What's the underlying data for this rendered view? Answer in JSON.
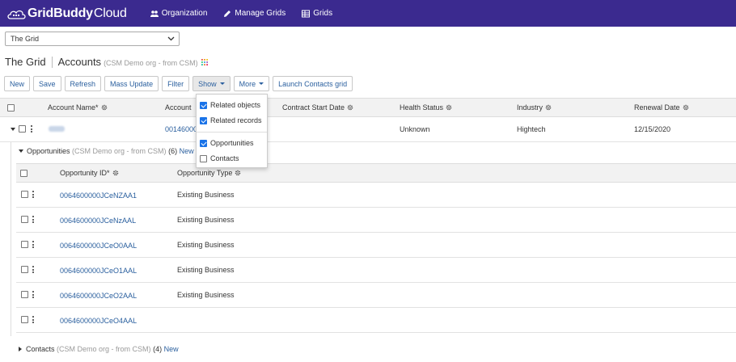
{
  "brand": {
    "name_bold": "GridBuddy",
    "name_light": "Cloud"
  },
  "nav": [
    {
      "label": "Organization",
      "icon": "users-icon"
    },
    {
      "label": "Manage Grids",
      "icon": "pencil-icon"
    },
    {
      "label": "Grids",
      "icon": "table-icon"
    }
  ],
  "grid_select": {
    "value": "The Grid"
  },
  "title": {
    "grid": "The Grid",
    "object": "Accounts",
    "org": "(CSM Demo org - from CSM)"
  },
  "toolbar": {
    "new": "New",
    "save": "Save",
    "refresh": "Refresh",
    "mass_update": "Mass Update",
    "filter": "Filter",
    "show": "Show",
    "more": "More",
    "launch": "Launch Contacts grid"
  },
  "main_table": {
    "headers": [
      "Account Name",
      "Account",
      "Contract Start Date",
      "Health Status",
      "Industry",
      "Renewal Date"
    ],
    "required_mark": "*",
    "row": {
      "account_id": "00146000",
      "health": "Unknown",
      "industry": "Hightech",
      "renewal": "12/15/2020"
    }
  },
  "show_menu": {
    "items": [
      {
        "label": "Related objects",
        "checked": true
      },
      {
        "label": "Related records",
        "checked": true
      },
      {
        "label": "Opportunities",
        "checked": true
      },
      {
        "label": "Contacts",
        "checked": false
      }
    ]
  },
  "opportunities": {
    "title": "Opportunities",
    "org": "(CSM Demo org - from CSM)",
    "count": "(6)",
    "new": "New",
    "headers": [
      "Opportunity ID",
      "Opportunity Type"
    ],
    "required_mark": "*",
    "rows": [
      {
        "id": "0064600000JCeNZAA1",
        "type": "Existing Business"
      },
      {
        "id": "0064600000JCeNzAAL",
        "type": "Existing Business"
      },
      {
        "id": "0064600000JCeO0AAL",
        "type": "Existing Business"
      },
      {
        "id": "0064600000JCeO1AAL",
        "type": "Existing Business"
      },
      {
        "id": "0064600000JCeO2AAL",
        "type": "Existing Business"
      },
      {
        "id": "0064600000JCeO4AAL",
        "type": ""
      }
    ]
  },
  "contacts": {
    "title": "Contacts",
    "org": "(CSM Demo org - from CSM)",
    "count": "(4)",
    "new": "New"
  }
}
